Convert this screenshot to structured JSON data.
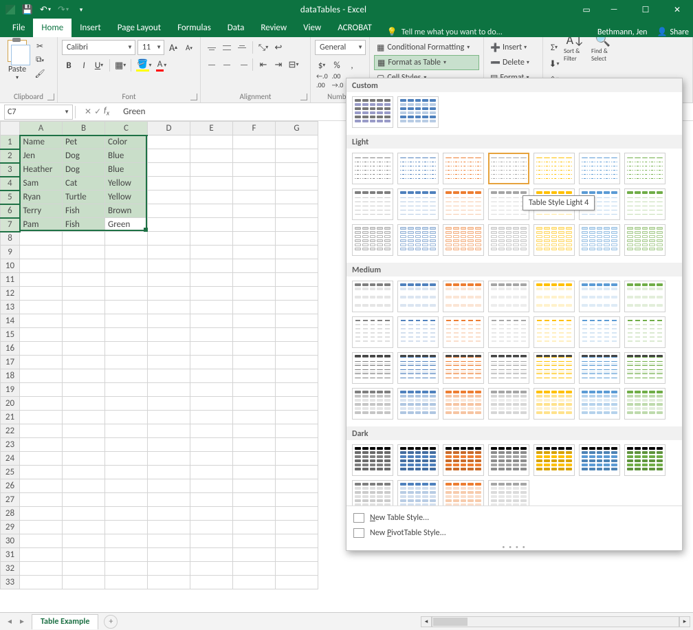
{
  "title": "dataTables - Excel",
  "user": "Bethmann, Jen",
  "share_label": "Share",
  "tellme_placeholder": "Tell me what you want to do...",
  "tabs": [
    "File",
    "Home",
    "Insert",
    "Page Layout",
    "Formulas",
    "Data",
    "Review",
    "View",
    "ACROBAT"
  ],
  "active_tab": "Home",
  "ribbon": {
    "clipboard_label": "Clipboard",
    "paste_label": "Paste",
    "font_label": "Font",
    "font_name": "Calibri",
    "font_size": "11",
    "alignment_label": "Alignment",
    "number_label": "Number",
    "number_format": "General",
    "currency": "$",
    "percent": "%",
    "comma": ",",
    "styles": {
      "cond": "Conditional Formatting",
      "fat": "Format as Table",
      "cell": "Cell Styles"
    },
    "cells": {
      "insert": "Insert",
      "delete": "Delete",
      "format": "Format"
    },
    "editing": {
      "sort": "Sort & Filter",
      "find": "Find & Select"
    }
  },
  "namebox": "C7",
  "formula": "Green",
  "columns": [
    "A",
    "B",
    "C",
    "D",
    "E",
    "F",
    "G"
  ],
  "rows": 33,
  "data": [
    [
      "Name",
      "Pet",
      "Color"
    ],
    [
      "Jen",
      "Dog",
      "Blue"
    ],
    [
      "Heather",
      "Dog",
      "Blue"
    ],
    [
      "Sam",
      "Cat",
      "Yellow"
    ],
    [
      "Ryan",
      "Turtle",
      "Yellow"
    ],
    [
      "Terry",
      "Fish",
      "Brown"
    ],
    [
      "Pam",
      "Fish",
      "Green"
    ]
  ],
  "selection": {
    "from_row": 1,
    "to_row": 7,
    "from_col": 1,
    "to_col": 3,
    "active_cell": "C7"
  },
  "sheet_tab": "Table Example",
  "gallery": {
    "sections": [
      "Custom",
      "Light",
      "Medium",
      "Dark"
    ],
    "hover_tooltip": "Table Style Light 4",
    "new_table": "New Table Style...",
    "new_pivot": "New PivotTable Style...",
    "palette_cols": [
      "#7f7f7f",
      "#4f81bd",
      "#ed7d31",
      "#a5a5a5",
      "#ffc000",
      "#5b9bd5",
      "#70ad47"
    ],
    "custom_count": 2,
    "light_rows": 3,
    "medium_rows": 4,
    "dark_rows": 2,
    "dark_last_row_count": 4
  }
}
